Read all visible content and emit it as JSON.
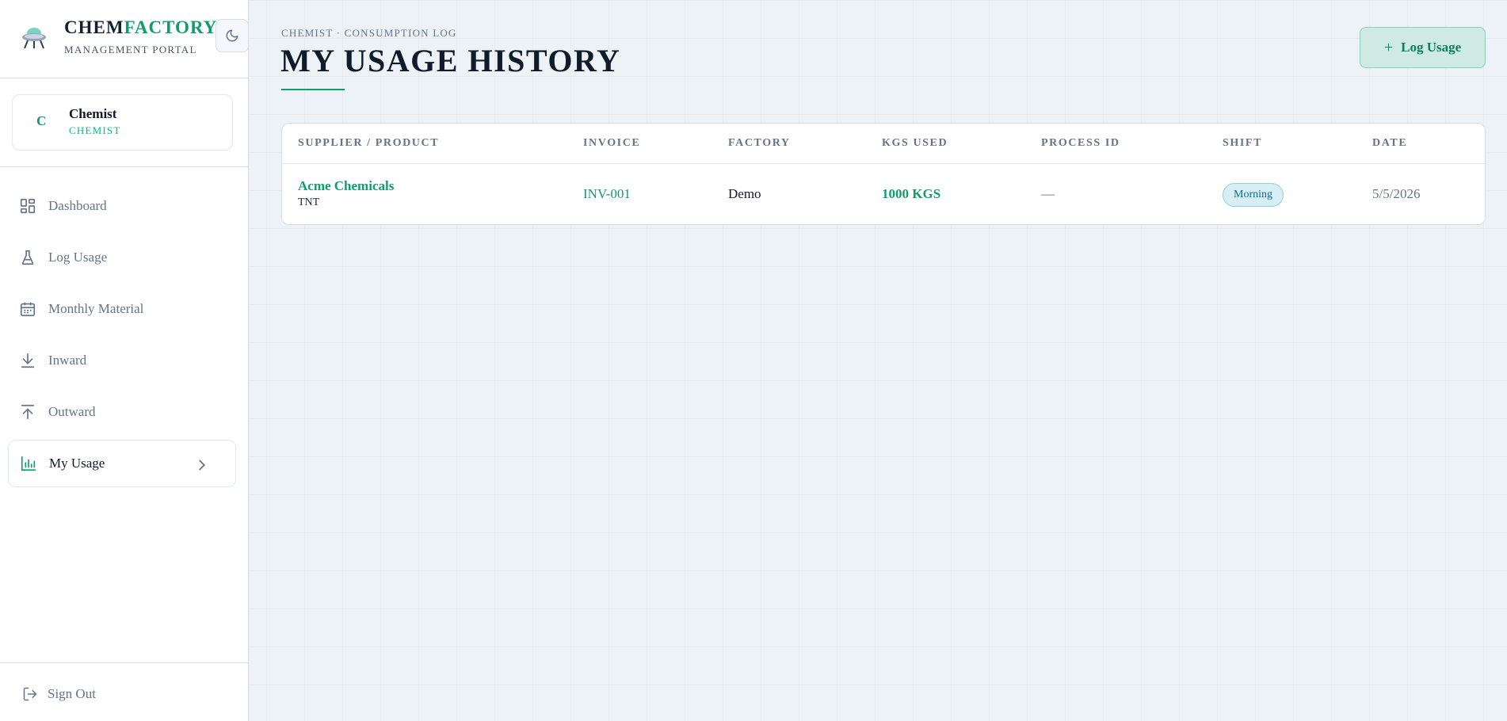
{
  "brand": {
    "name_part1": "CHEM",
    "name_part2": "FACTORY",
    "subtitle": "MANAGEMENT PORTAL"
  },
  "user": {
    "initial": "C",
    "name": "Chemist",
    "role": "CHEMIST"
  },
  "nav": {
    "items": [
      {
        "label": "Dashboard",
        "icon": "dashboard-icon"
      },
      {
        "label": "Log Usage",
        "icon": "flask-icon"
      },
      {
        "label": "Monthly Material",
        "icon": "calendar-icon"
      },
      {
        "label": "Inward",
        "icon": "arrow-down-icon"
      },
      {
        "label": "Outward",
        "icon": "arrow-up-icon"
      },
      {
        "label": "My Usage",
        "icon": "bar-chart-icon",
        "active": true
      }
    ],
    "sign_out": "Sign Out"
  },
  "header": {
    "breadcrumb": "CHEMIST · CONSUMPTION LOG",
    "title": "MY USAGE HISTORY",
    "log_button": "Log Usage"
  },
  "table": {
    "columns": [
      "SUPPLIER / PRODUCT",
      "INVOICE",
      "FACTORY",
      "KGS USED",
      "PROCESS ID",
      "SHIFT",
      "DATE"
    ],
    "rows": [
      {
        "supplier": "Acme Chemicals",
        "product": "TNT",
        "invoice": "INV-001",
        "factory": "Demo",
        "kgs_used": "1000 KGS",
        "process_id": "—",
        "shift": "Morning",
        "date": "5/5/2026"
      }
    ]
  },
  "colors": {
    "accent": "#0f9d6c",
    "sidebar_bg": "#ffffff",
    "page_bg": "#edf2f6",
    "shift_badge": "#d7eef4"
  }
}
